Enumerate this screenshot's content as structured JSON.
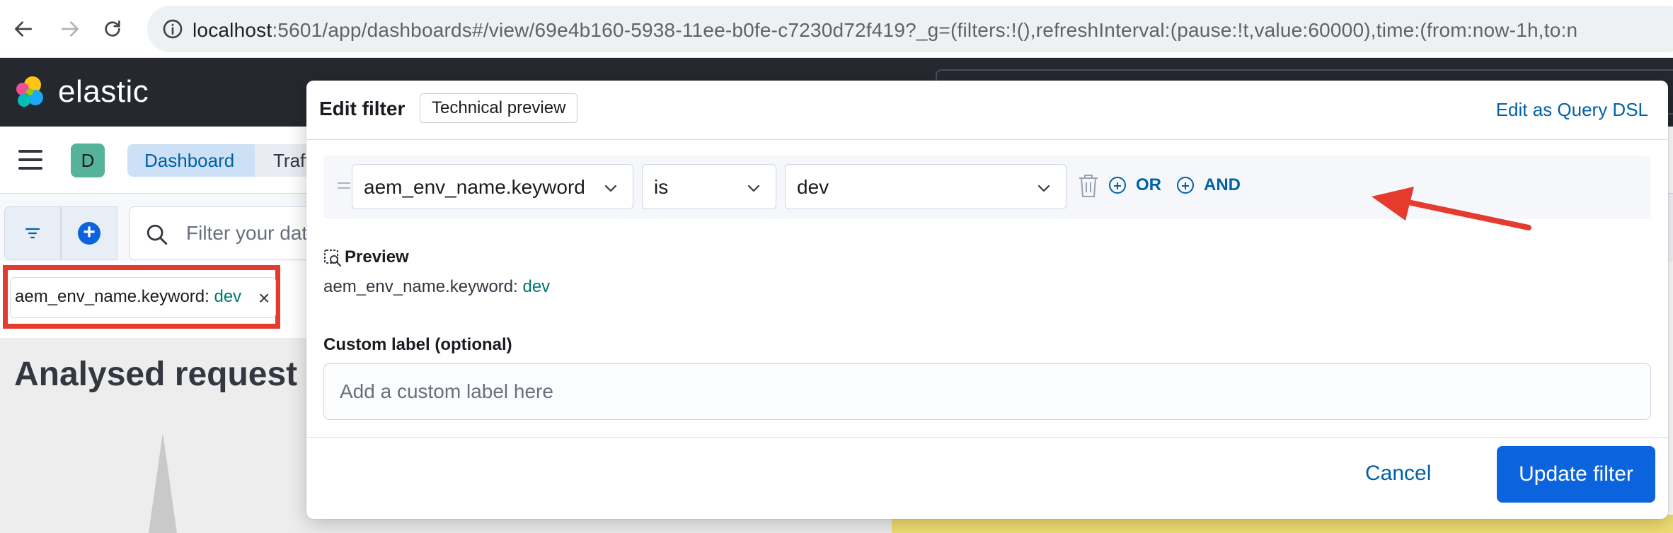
{
  "browser": {
    "url_host": "localhost",
    "url_path": ":5601/app/dashboards#/view/69e4b160-5938-11ee-b0fe-c7230d72f419?_g=(filters:!(),refreshInterval:(pause:!t,value:60000),time:(from:now-1h,to:n"
  },
  "kibana": {
    "brand": "elastic",
    "space_initial": "D",
    "breadcrumbs": [
      "Dashboard",
      "Traff"
    ]
  },
  "query_bar": {
    "placeholder": "Filter your dat"
  },
  "filter_pill": {
    "field": "aem_env_name.keyword: ",
    "value": "dev",
    "remove_glyph": "×"
  },
  "panel": {
    "title": "Analysed request"
  },
  "edit_filter": {
    "title": "Edit filter",
    "badge": "Technical preview",
    "dsl_link": "Edit as Query DSL",
    "field": "aem_env_name.keyword",
    "operator": "is",
    "value": "dev",
    "or_label": "OR",
    "and_label": "AND",
    "preview_title": "Preview",
    "preview_field": "aem_env_name.keyword: ",
    "preview_value": "dev",
    "custom_label_title": "Custom label (optional)",
    "custom_label_placeholder": "Add a custom label here",
    "cancel_label": "Cancel",
    "update_label": "Update filter"
  },
  "colors": {
    "accent": "#0b64dd",
    "link": "#0061a6",
    "value_teal": "#007871",
    "annotation_red": "#e43b2e",
    "header_dark": "#25282f"
  },
  "icons": [
    "back-icon",
    "forward-icon",
    "reload-icon",
    "site-info-icon",
    "elastic-logo-icon",
    "hamburger-icon",
    "filter-icon",
    "add-icon",
    "search-icon",
    "close-icon",
    "chevron-down-icon",
    "trash-icon",
    "plus-circle-icon",
    "preview-icon",
    "drag-handle-icon"
  ]
}
